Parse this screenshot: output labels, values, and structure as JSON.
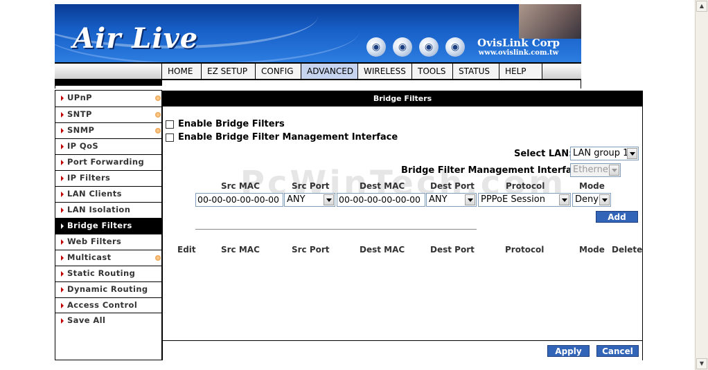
{
  "header": {
    "brand": "Air Live",
    "corp_name": "OvisLink Corp",
    "corp_url": "www.ovislink.com.tw"
  },
  "nav": {
    "tabs": [
      "HOME",
      "EZ SETUP",
      "CONFIG",
      "ADVANCED",
      "WIRELESS",
      "TOOLS",
      "STATUS",
      "HELP"
    ],
    "active": "ADVANCED"
  },
  "sidebar": {
    "items": [
      {
        "label": "UPnP",
        "dot": true
      },
      {
        "label": "SNTP",
        "dot": true
      },
      {
        "label": "SNMP",
        "dot": true
      },
      {
        "label": "IP QoS",
        "dot": false
      },
      {
        "label": "Port Forwarding",
        "dot": false
      },
      {
        "label": "IP Filters",
        "dot": false
      },
      {
        "label": "LAN Clients",
        "dot": false
      },
      {
        "label": "LAN Isolation",
        "dot": false
      },
      {
        "label": "Bridge Filters",
        "dot": false,
        "active": true
      },
      {
        "label": "Web Filters",
        "dot": false
      },
      {
        "label": "Multicast",
        "dot": true
      },
      {
        "label": "Static Routing",
        "dot": false
      },
      {
        "label": "Dynamic Routing",
        "dot": false
      },
      {
        "label": "Access Control",
        "dot": false
      },
      {
        "label": "Save All",
        "dot": false
      }
    ]
  },
  "panel": {
    "title": "Bridge Filters",
    "enable_filters_label": "Enable Bridge Filters",
    "enable_mgmt_label": "Enable Bridge Filter Management Interface",
    "select_lan_label": "Select LAN:",
    "select_lan_value": "LAN group 1",
    "mgmt_iface_label": "Bridge Filter Management Interface:",
    "mgmt_iface_value": "Ethernet",
    "watermark": "PcWinTech.com",
    "columns": {
      "src_mac": "Src MAC",
      "src_port": "Src Port",
      "dest_mac": "Dest MAC",
      "dest_port": "Dest Port",
      "protocol": "Protocol",
      "mode": "Mode"
    },
    "new_rule": {
      "src_mac": "00-00-00-00-00-00",
      "src_port": "ANY",
      "dest_mac": "00-00-00-00-00-00",
      "dest_port": "ANY",
      "protocol": "PPPoE Session",
      "mode": "Deny"
    },
    "add_label": "Add",
    "table_headers": {
      "edit": "Edit",
      "src_mac": "Src MAC",
      "src_port": "Src Port",
      "dest_mac": "Dest MAC",
      "dest_port": "Dest Port",
      "protocol": "Protocol",
      "mode": "Mode",
      "delete": "Delete"
    },
    "apply_label": "Apply",
    "cancel_label": "Cancel"
  }
}
